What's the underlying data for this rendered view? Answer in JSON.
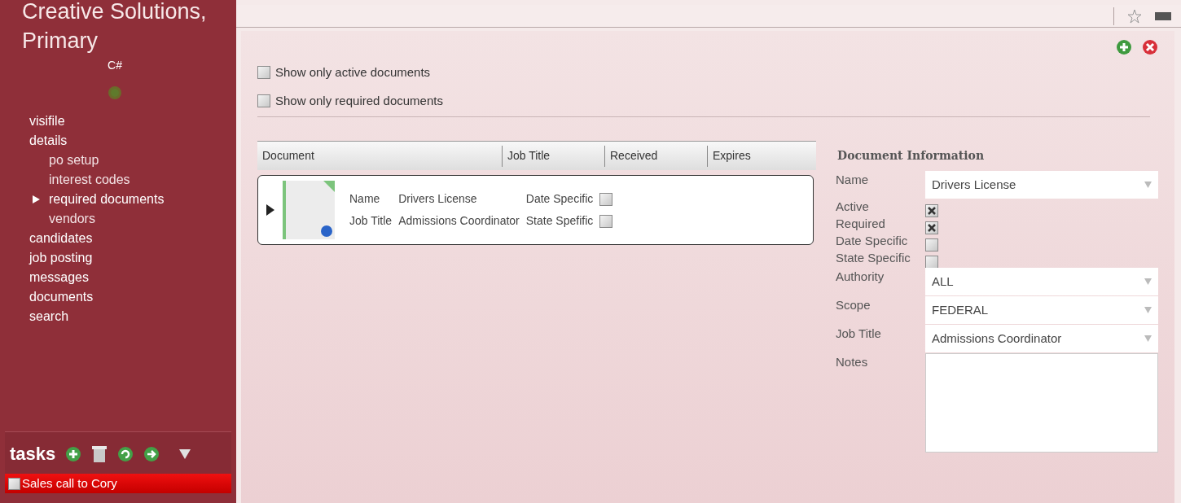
{
  "sidebar": {
    "title_lines": [
      "Creative Solutions,",
      "Primary"
    ],
    "subtitle": "C#",
    "nav": [
      {
        "label": "visifile"
      },
      {
        "label": "details",
        "children": [
          {
            "label": "po setup",
            "selected": false
          },
          {
            "label": "interest codes",
            "selected": false
          },
          {
            "label": "required documents",
            "selected": true
          },
          {
            "label": "vendors",
            "selected": false
          }
        ]
      },
      {
        "label": "candidates"
      },
      {
        "label": "job posting"
      },
      {
        "label": "messages"
      },
      {
        "label": "documents"
      },
      {
        "label": "search"
      }
    ],
    "tasks": {
      "title": "tasks",
      "items": [
        {
          "label": "Sales call to Cory",
          "checked": false
        }
      ]
    }
  },
  "filters": [
    {
      "label": "Show only active documents",
      "checked": false
    },
    {
      "label": "Show only required documents",
      "checked": false
    }
  ],
  "table": {
    "columns": [
      "Document",
      "Job Title",
      "Received",
      "Expires"
    ],
    "rows": [
      {
        "expanded": false,
        "name_label": "Name",
        "name": "Drivers License",
        "job_title_label": "Job Title",
        "job_title": "Admissions Coordinator",
        "date_label": "Date Specific",
        "date_specific": false,
        "state_label": "State Spefific",
        "state_specific": false
      }
    ]
  },
  "details": {
    "title": "Document Information",
    "fields": [
      {
        "kind": "dropdown",
        "label": "Name",
        "value": "Drivers License"
      },
      {
        "kind": "checkbox",
        "label": "Active",
        "checked": true
      },
      {
        "kind": "checkbox",
        "label": "Required",
        "checked": true
      },
      {
        "kind": "checkbox",
        "label": "Date Specific",
        "checked": false
      },
      {
        "kind": "checkbox",
        "label": "State Specific",
        "checked": false
      },
      {
        "kind": "dropdown",
        "label": "Authority",
        "value": "ALL"
      },
      {
        "kind": "dropdown",
        "label": "Scope",
        "value": "FEDERAL"
      },
      {
        "kind": "dropdown",
        "label": "Job Title",
        "value": "Admissions Coordinator"
      },
      {
        "kind": "textarea",
        "label": "Notes"
      }
    ]
  }
}
